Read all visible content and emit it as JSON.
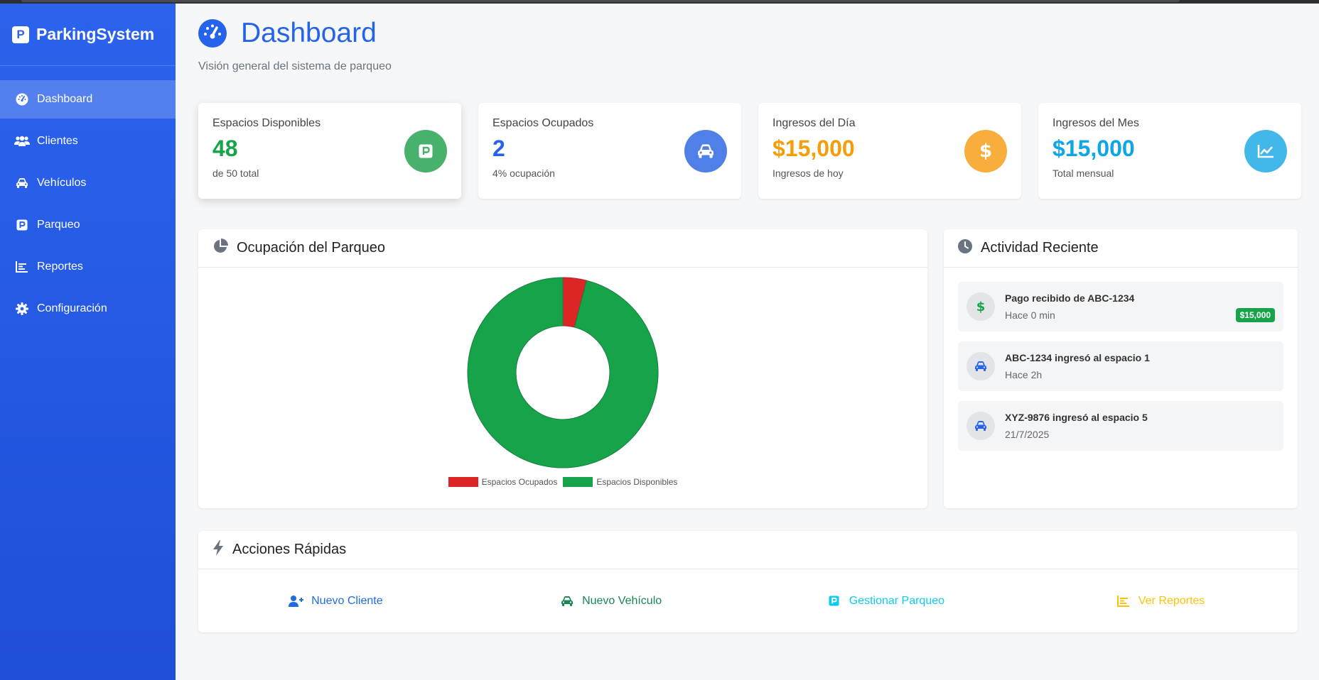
{
  "app": {
    "brand": "ParkingSystem",
    "brand_logo_letter": "P"
  },
  "sidebar": {
    "items": [
      {
        "label": "Dashboard",
        "icon": "gauge-icon",
        "active": true
      },
      {
        "label": "Clientes",
        "icon": "users-icon"
      },
      {
        "label": "Vehículos",
        "icon": "car-icon"
      },
      {
        "label": "Parqueo",
        "icon": "parking-icon"
      },
      {
        "label": "Reportes",
        "icon": "bar-chart-icon"
      },
      {
        "label": "Configuración",
        "icon": "gear-icon"
      }
    ]
  },
  "header": {
    "title": "Dashboard",
    "subtitle": "Visión general del sistema de parqueo",
    "icon": "gauge-icon"
  },
  "stats": [
    {
      "label": "Espacios Disponibles",
      "value": "48",
      "note": "de 50 total",
      "color": "#16a34a",
      "icon_bg": "#48b16b",
      "icon": "parking-icon"
    },
    {
      "label": "Espacios Ocupados",
      "value": "2",
      "note": "4% ocupación",
      "color": "#2563eb",
      "icon_bg": "#4f80e8",
      "icon": "car-icon"
    },
    {
      "label": "Ingresos del Día",
      "value": "$15,000",
      "note": "Ingresos de hoy",
      "color": "#f59e0b",
      "icon_bg": "#f8ad3c",
      "icon": "dollar-icon"
    },
    {
      "label": "Ingresos del Mes",
      "value": "$15,000",
      "note": "Total mensual",
      "color": "#0ea5e9",
      "icon_bg": "#42b8ea",
      "icon": "line-chart-icon"
    }
  ],
  "occupancy": {
    "title": "Ocupación del Parqueo",
    "icon": "pie-chart-icon"
  },
  "chart_data": {
    "type": "pie",
    "categories": [
      "Espacios Ocupados",
      "Espacios Disponibles"
    ],
    "values": [
      2,
      48
    ],
    "colors": [
      "#dc2626",
      "#16a34a"
    ],
    "legend": "bottom",
    "donut": true
  },
  "activity": {
    "title": "Actividad Reciente",
    "icon": "clock-icon",
    "items": [
      {
        "title": "Pago recibido de ABC-1234",
        "time": "Hace 0 min",
        "badge": "$15,000",
        "icon": "dollar-icon",
        "icon_color": "#16a34a"
      },
      {
        "title": "ABC-1234 ingresó al espacio 1",
        "time": "Hace 2h",
        "icon": "car-icon",
        "icon_color": "#2563eb"
      },
      {
        "title": "XYZ-9876 ingresó al espacio 5",
        "time": "21/7/2025",
        "icon": "car-icon",
        "icon_color": "#2563eb"
      }
    ]
  },
  "quick_actions": {
    "title": "Acciones Rápidas",
    "icon": "bolt-icon",
    "items": [
      {
        "label": "Nuevo Cliente",
        "icon": "user-plus-icon",
        "color": "#1d6fe0"
      },
      {
        "label": "Nuevo Vehículo",
        "icon": "car-icon",
        "color": "#198754"
      },
      {
        "label": "Gestionar Parqueo",
        "icon": "parking-icon",
        "color": "#0dcaf0"
      },
      {
        "label": "Ver Reportes",
        "icon": "bar-chart-icon",
        "color": "#ffc107"
      }
    ]
  }
}
